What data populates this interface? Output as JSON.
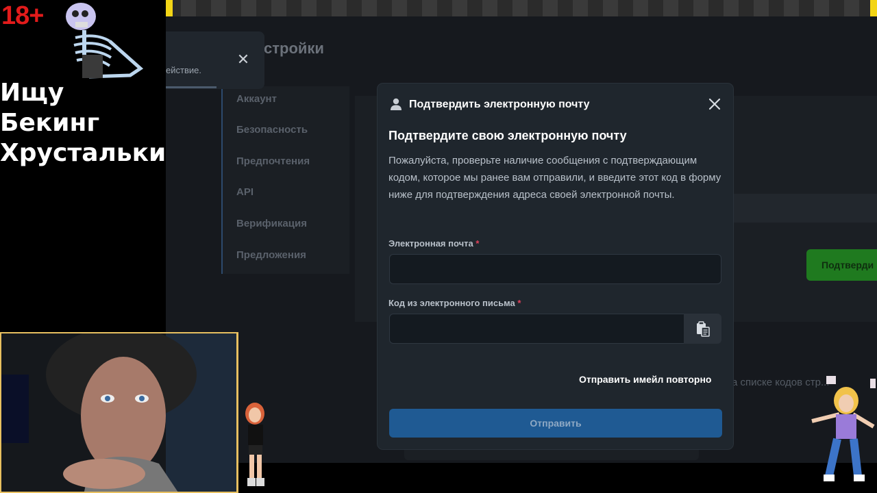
{
  "overlay": {
    "age_tag": "18+",
    "title_line1": "Ищу Бекинг",
    "title_line2": "Хрустальки"
  },
  "background_page": {
    "title": "стройки",
    "nav": [
      "Аккаунт",
      "Безопасность",
      "Предпочтения",
      "API",
      "Верификация",
      "Предложения"
    ],
    "green_button": "Подтверди",
    "partial_text": "а списке кодов стр..."
  },
  "toast": {
    "text": "ействие."
  },
  "modal": {
    "header_title": "Подтвердить электронную почту",
    "heading": "Подтвердите свою электронную почту",
    "description": "Пожалуйста, проверьте наличие сообщения с подтверждающим кодом, которое мы ранее вам отправили, и введите этот код в форму ниже для подтверждения адреса своей электронной почты.",
    "email_label": "Электронная почта",
    "email_value": "",
    "code_label": "Код из электронного письма",
    "code_value": "",
    "required_mark": "*",
    "resend_label": "Отправить имейл повторно",
    "submit_label": "Отправить"
  },
  "colors": {
    "accent": "#1f5a93",
    "required": "#e0415a",
    "green": "#1f7a1f"
  }
}
